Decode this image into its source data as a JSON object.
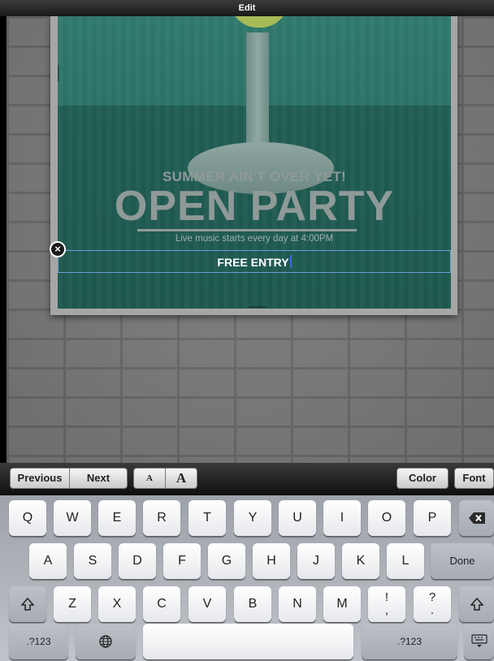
{
  "window": {
    "title": "Edit"
  },
  "poster": {
    "subtitle": "SUMMER AIN'T OVER YET!",
    "title": "OPEN PARTY",
    "tagline": "Live music starts every day at 4:00PM",
    "entry_text": "FREE ENTRY",
    "delete_icon": "close-circle-icon"
  },
  "toolbar": {
    "previous": "Previous",
    "next": "Next",
    "font_smaller": "A",
    "font_larger": "A",
    "color": "Color",
    "font": "Font"
  },
  "keyboard": {
    "row1": [
      "Q",
      "W",
      "E",
      "R",
      "T",
      "Y",
      "U",
      "I",
      "O",
      "P"
    ],
    "row2": [
      "A",
      "S",
      "D",
      "F",
      "G",
      "H",
      "J",
      "K",
      "L"
    ],
    "row3": [
      "Z",
      "X",
      "C",
      "V",
      "B",
      "N",
      "M"
    ],
    "done": "Done",
    "numbers": ".?123",
    "exclam": "!",
    "comma": ",",
    "question": "?",
    "period": "."
  }
}
